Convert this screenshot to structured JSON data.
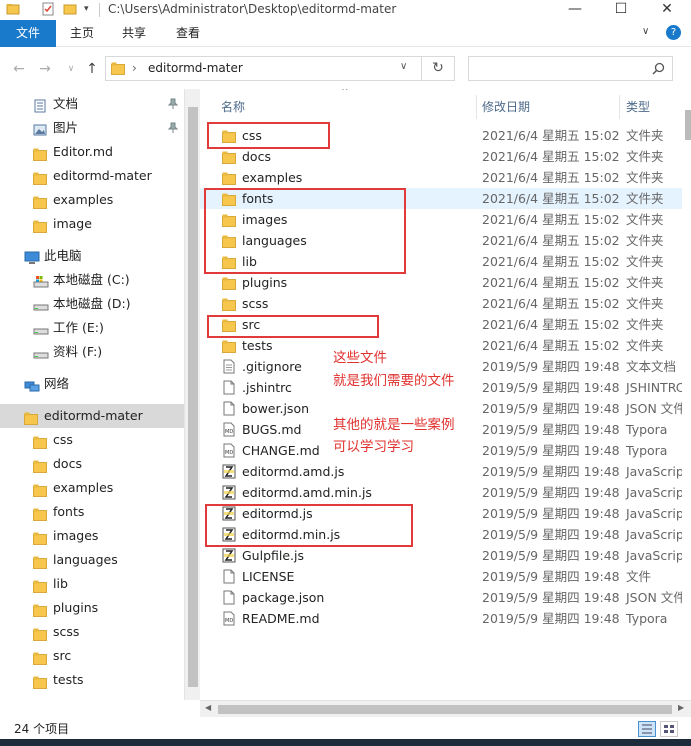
{
  "window": {
    "path": "C:\\Users\\Administrator\\Desktop\\editormd-mater",
    "minimize": "—",
    "maximize": "☐",
    "close": "✕"
  },
  "ribbon": {
    "tabs": [
      "文件",
      "主页",
      "共享",
      "查看"
    ],
    "help": "?"
  },
  "address": {
    "back": "←",
    "forward": "→",
    "recent": "∨",
    "up": "↑",
    "crumb_sep": "›",
    "current": "editormd-mater",
    "dropdown": "∨",
    "refresh": "↻",
    "search_placeholder": ""
  },
  "sidebar": {
    "quick_access": [
      {
        "label": "文档",
        "icon": "documents-icon",
        "pinned": true
      },
      {
        "label": "图片",
        "icon": "pictures-icon",
        "pinned": true
      },
      {
        "label": "Editor.md",
        "icon": "folder-icon",
        "pinned": false
      },
      {
        "label": "editormd-mater",
        "icon": "folder-icon",
        "pinned": false
      },
      {
        "label": "examples",
        "icon": "folder-icon",
        "pinned": false
      },
      {
        "label": "image",
        "icon": "folder-icon",
        "pinned": false
      }
    ],
    "this_pc": "此电脑",
    "drives": [
      {
        "label": "本地磁盘 (C:)",
        "icon": "drive-c-icon"
      },
      {
        "label": "本地磁盘 (D:)",
        "icon": "drive-icon"
      },
      {
        "label": "工作 (E:)",
        "icon": "drive-icon"
      },
      {
        "label": "资料 (F:)",
        "icon": "drive-icon"
      }
    ],
    "network": "网络",
    "current_folder": "editormd-mater",
    "subfolders": [
      "css",
      "docs",
      "examples",
      "fonts",
      "images",
      "languages",
      "lib",
      "plugins",
      "scss",
      "src",
      "tests"
    ]
  },
  "columns": {
    "name": "名称",
    "date": "修改日期",
    "type": "类型"
  },
  "files": [
    {
      "name": "css",
      "date": "2021/6/4 星期五 15:02",
      "type": "文件夹",
      "icon": "folder-icon"
    },
    {
      "name": "docs",
      "date": "2021/6/4 星期五 15:02",
      "type": "文件夹",
      "icon": "folder-icon"
    },
    {
      "name": "examples",
      "date": "2021/6/4 星期五 15:02",
      "type": "文件夹",
      "icon": "folder-icon"
    },
    {
      "name": "fonts",
      "date": "2021/6/4 星期五 15:02",
      "type": "文件夹",
      "icon": "folder-icon"
    },
    {
      "name": "images",
      "date": "2021/6/4 星期五 15:02",
      "type": "文件夹",
      "icon": "folder-icon"
    },
    {
      "name": "languages",
      "date": "2021/6/4 星期五 15:02",
      "type": "文件夹",
      "icon": "folder-icon"
    },
    {
      "name": "lib",
      "date": "2021/6/4 星期五 15:02",
      "type": "文件夹",
      "icon": "folder-icon"
    },
    {
      "name": "plugins",
      "date": "2021/6/4 星期五 15:02",
      "type": "文件夹",
      "icon": "folder-icon"
    },
    {
      "name": "scss",
      "date": "2021/6/4 星期五 15:02",
      "type": "文件夹",
      "icon": "folder-icon"
    },
    {
      "name": "src",
      "date": "2021/6/4 星期五 15:02",
      "type": "文件夹",
      "icon": "folder-icon"
    },
    {
      "name": "tests",
      "date": "2021/6/4 星期五 15:02",
      "type": "文件夹",
      "icon": "folder-icon"
    },
    {
      "name": ".gitignore",
      "date": "2019/5/9 星期四 19:48",
      "type": "文本文档",
      "icon": "text-file-icon"
    },
    {
      "name": ".jshintrc",
      "date": "2019/5/9 星期四 19:48",
      "type": "JSHINTRC",
      "icon": "file-icon"
    },
    {
      "name": "bower.json",
      "date": "2019/5/9 星期四 19:48",
      "type": "JSON 文件",
      "icon": "file-icon"
    },
    {
      "name": "BUGS.md",
      "date": "2019/5/9 星期四 19:48",
      "type": "Typora",
      "icon": "md-file-icon"
    },
    {
      "name": "CHANGE.md",
      "date": "2019/5/9 星期四 19:48",
      "type": "Typora",
      "icon": "md-file-icon"
    },
    {
      "name": "editormd.amd.js",
      "date": "2019/5/9 星期四 19:48",
      "type": "JavaScript",
      "icon": "js-file-icon"
    },
    {
      "name": "editormd.amd.min.js",
      "date": "2019/5/9 星期四 19:48",
      "type": "JavaScript",
      "icon": "js-file-icon"
    },
    {
      "name": "editormd.js",
      "date": "2019/5/9 星期四 19:48",
      "type": "JavaScript",
      "icon": "js-file-icon"
    },
    {
      "name": "editormd.min.js",
      "date": "2019/5/9 星期四 19:48",
      "type": "JavaScript",
      "icon": "js-file-icon"
    },
    {
      "name": "Gulpfile.js",
      "date": "2019/5/9 星期四 19:48",
      "type": "JavaScript",
      "icon": "js-file-icon"
    },
    {
      "name": "LICENSE",
      "date": "2019/5/9 星期四 19:48",
      "type": "文件",
      "icon": "file-icon"
    },
    {
      "name": "package.json",
      "date": "2019/5/9 星期四 19:48",
      "type": "JSON 文件",
      "icon": "file-icon"
    },
    {
      "name": "README.md",
      "date": "2019/5/9 星期四 19:48",
      "type": "Typora",
      "icon": "md-file-icon"
    }
  ],
  "hovered_file": "fonts",
  "annotations": {
    "line1": "这些文件",
    "line2": "就是我们需要的文件",
    "line3": "其他的就是一些案例",
    "line4": "可以学习学习",
    "color": "#e0312e"
  },
  "status": {
    "count": "24 个项目"
  },
  "colors": {
    "ribbon_file_tab": "#1979ca",
    "folder": "#f6c64d",
    "selection": "#d9d9d9",
    "hover": "#e5f3ff"
  }
}
